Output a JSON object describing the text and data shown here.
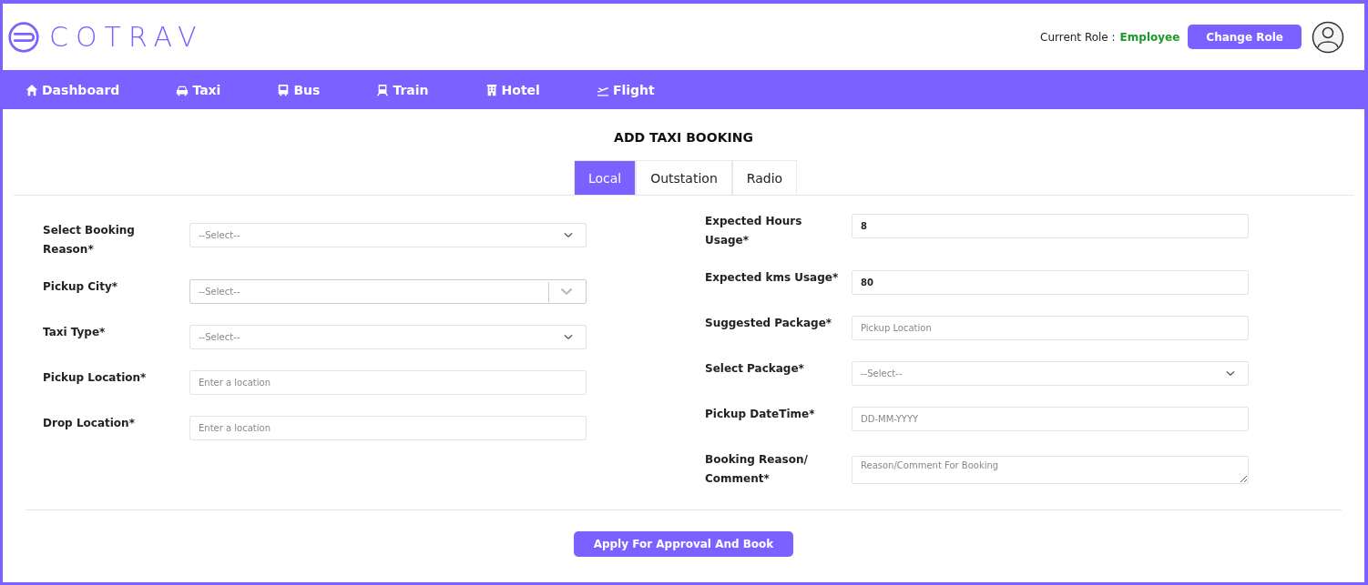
{
  "header": {
    "logo": "COTRAV",
    "role_label": "Current Role :",
    "role": "Employee",
    "change_role": "Change Role"
  },
  "nav": [
    {
      "label": "Dashboard"
    },
    {
      "label": "Taxi"
    },
    {
      "label": "Bus"
    },
    {
      "label": "Train"
    },
    {
      "label": "Hotel"
    },
    {
      "label": "Flight"
    }
  ],
  "form": {
    "title": "ADD TAXI BOOKING",
    "tabs": [
      {
        "label": "Local",
        "selected": true
      },
      {
        "label": "Outstation",
        "selected": false
      },
      {
        "label": "Radio",
        "selected": false
      }
    ],
    "left": [
      {
        "label": "Select Booking Reason*",
        "kind": "select",
        "placeholder": "--Select--"
      },
      {
        "label": "Pickup City*",
        "kind": "combo",
        "placeholder": "--Select--"
      },
      {
        "label": "Taxi Type*",
        "kind": "select",
        "placeholder": "--Select--"
      },
      {
        "label": "Pickup Location*",
        "kind": "input",
        "placeholder": "Enter a location"
      },
      {
        "label": "Drop Location*",
        "kind": "input",
        "placeholder": "Enter a location"
      }
    ],
    "right": [
      {
        "label": "Expected Hours Usage*",
        "kind": "input",
        "value": "8"
      },
      {
        "label": "Expected kms Usage*",
        "kind": "input",
        "value": "80"
      },
      {
        "label": "Suggested Package*",
        "kind": "input",
        "placeholder": "Pickup Location"
      },
      {
        "label": "Select Package*",
        "kind": "select",
        "placeholder": "--Select--"
      },
      {
        "label": "Pickup DateTime*",
        "kind": "input",
        "placeholder": "DD-MM-YYYY"
      },
      {
        "label": "Booking Reason/ Comment*",
        "kind": "textarea",
        "placeholder": "Reason/Comment For Booking"
      }
    ],
    "submit": "Apply For Approval And Book"
  }
}
